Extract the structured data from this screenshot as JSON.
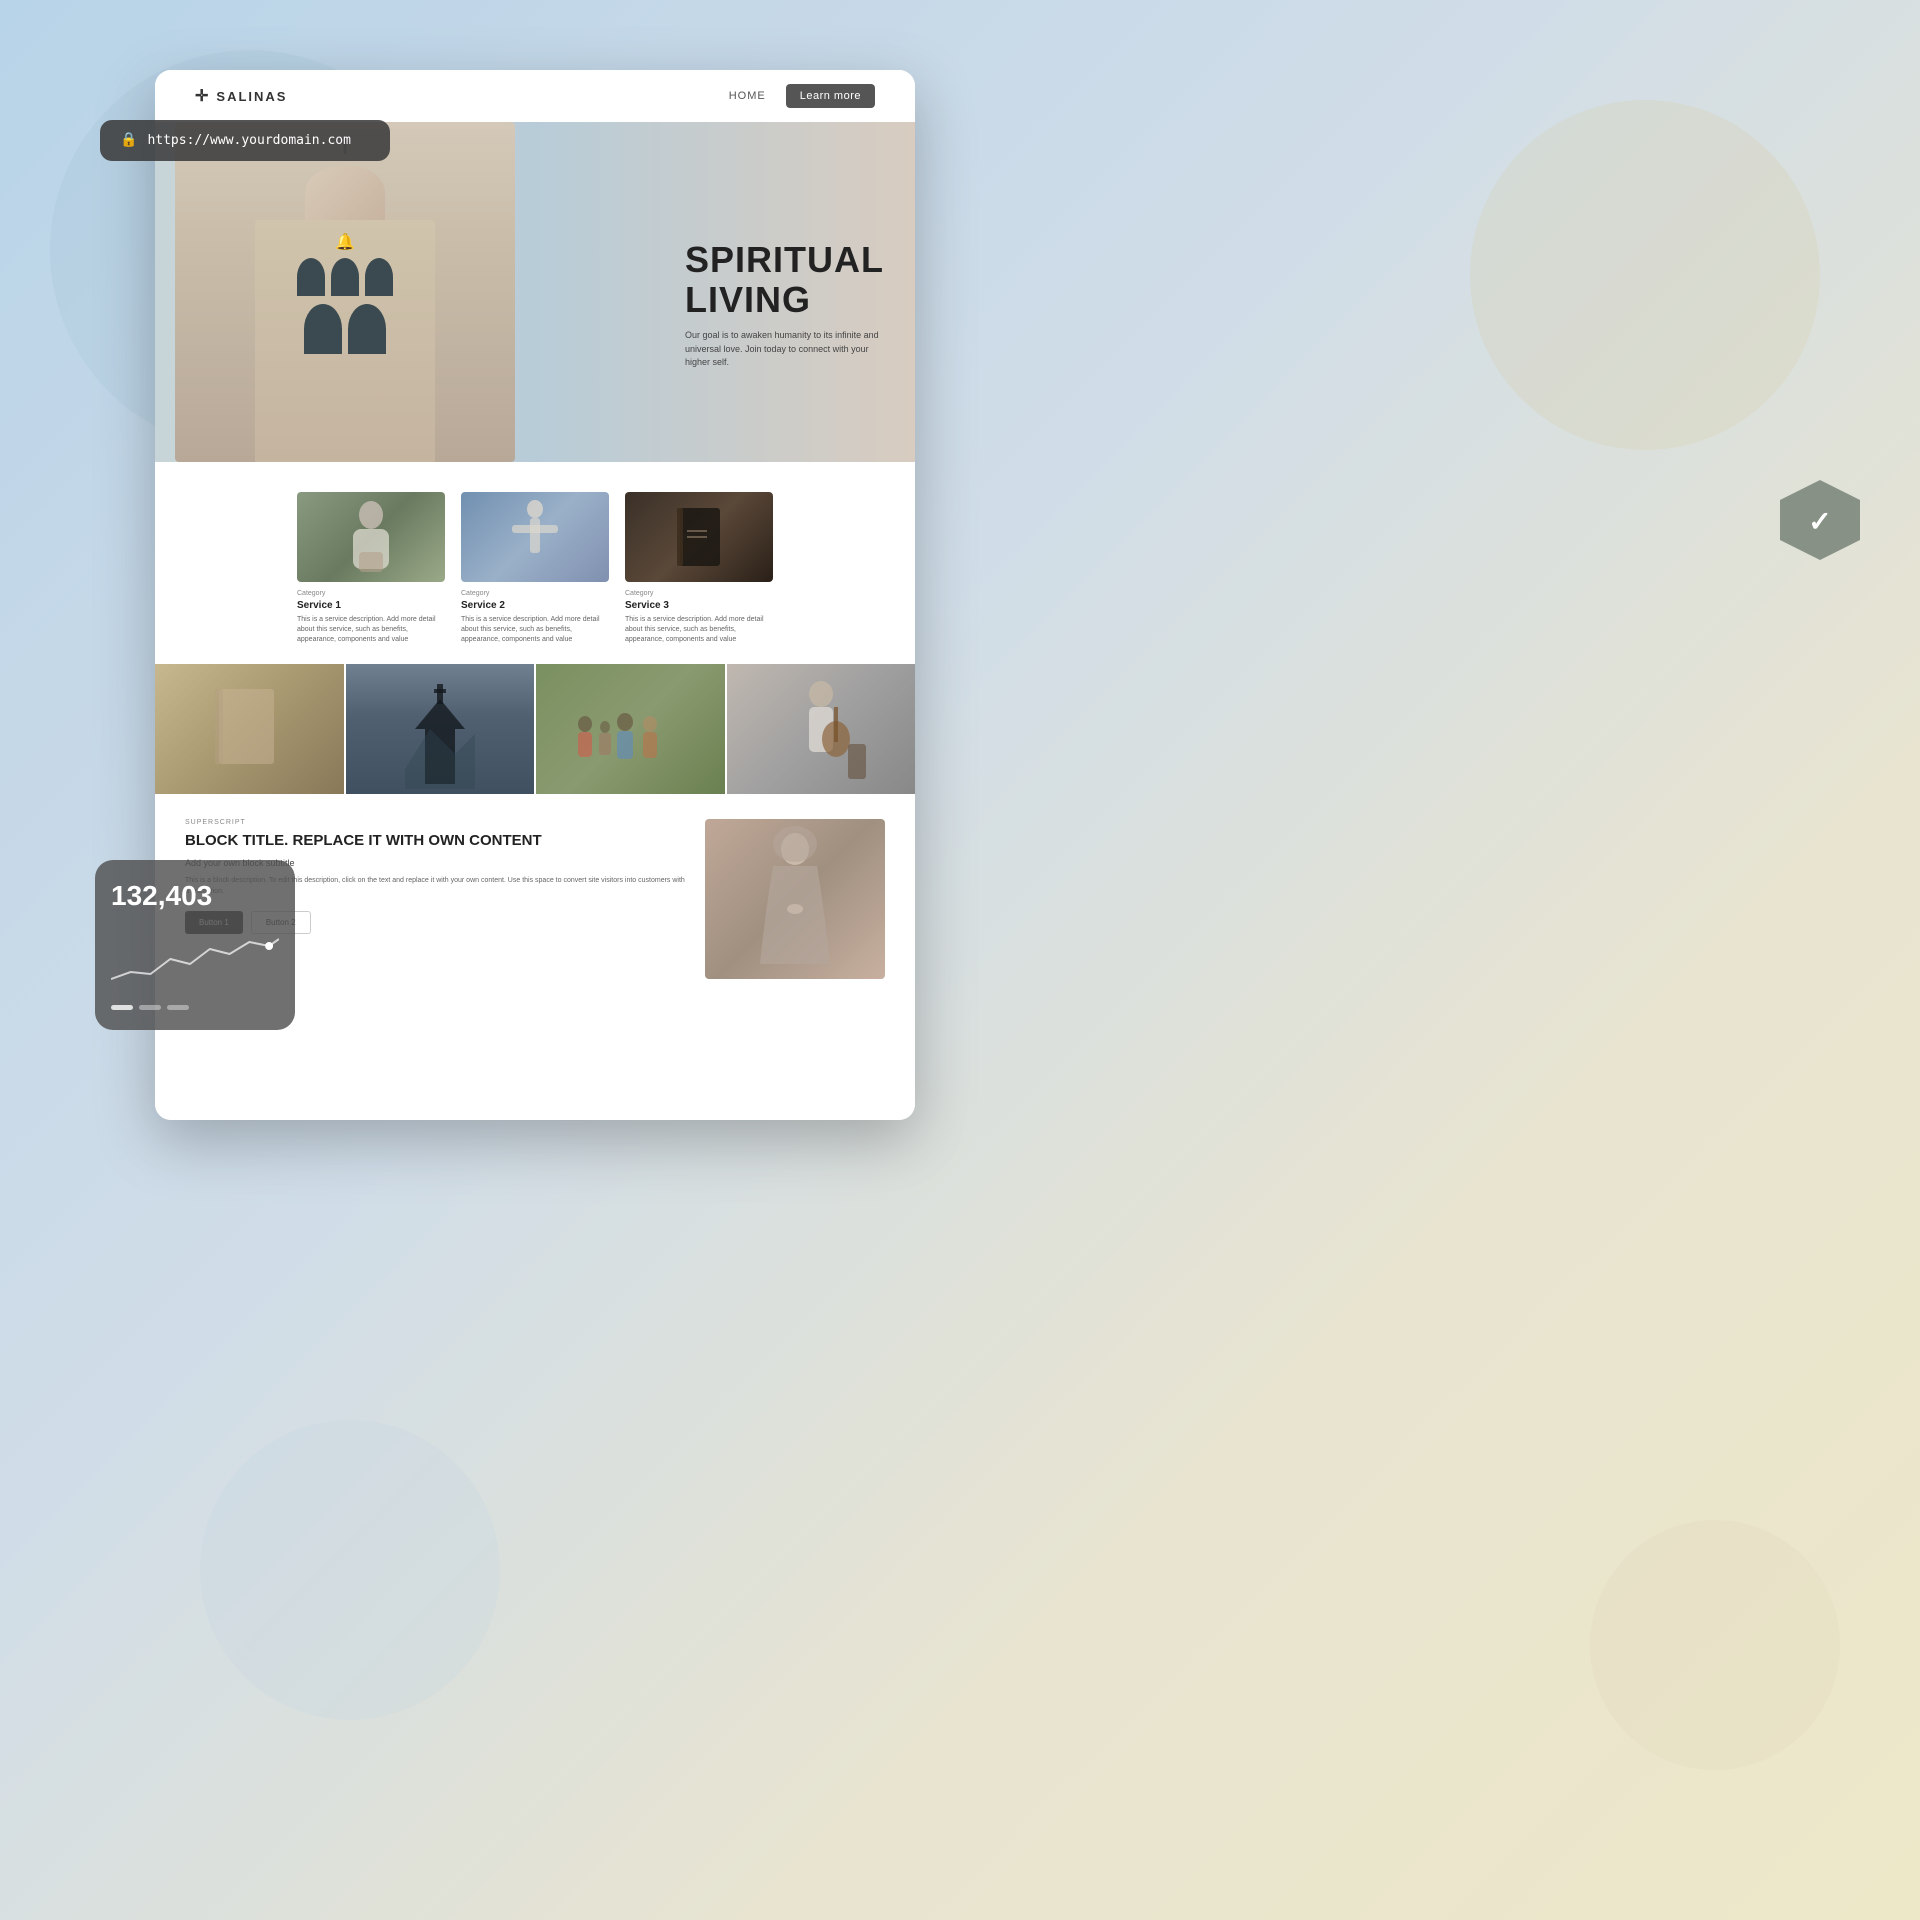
{
  "background": {
    "color_start": "#b8d4e8",
    "color_end": "#ede8c8"
  },
  "url_bar": {
    "url": "https://www.yourdomain.com",
    "lock_icon": "🔒"
  },
  "nav": {
    "logo_text": "SALINAS",
    "logo_cross": "✛",
    "home_label": "HOME",
    "learn_more_label": "Learn more"
  },
  "hero": {
    "title_line1": "SPIRITUAL",
    "title_line2": "LIVING",
    "subtitle": "Our goal is to awaken humanity to its infinite and universal love. Join today to connect with your higher self."
  },
  "services": {
    "items": [
      {
        "category": "Category",
        "title": "Service 1",
        "description": "This is a service description. Add more detail about this service, such as benefits, appearance, components and value"
      },
      {
        "category": "Category",
        "title": "Service 2",
        "description": "This is a service description. Add more detail about this service, such as benefits, appearance, components and value"
      },
      {
        "category": "Category",
        "title": "Service 3",
        "description": "This is a service description. Add more detail about this service, such as benefits, appearance, components and value"
      }
    ]
  },
  "bottom_block": {
    "superscript": "SUPERSCRIPT",
    "title": "BLOCK TITLE. REPLACE IT WITH OWN CONTENT",
    "subtitle": "Add your own block subtitle",
    "description": "This is a block description. To edit this description, click on the text and replace it with your own content. Use this space to convert site visitors into customers with a promotion.",
    "button1": "Button 1",
    "button2": "Button 2"
  },
  "stats_widget": {
    "number": "132,403"
  },
  "shield_badge": {
    "check": "✓"
  }
}
